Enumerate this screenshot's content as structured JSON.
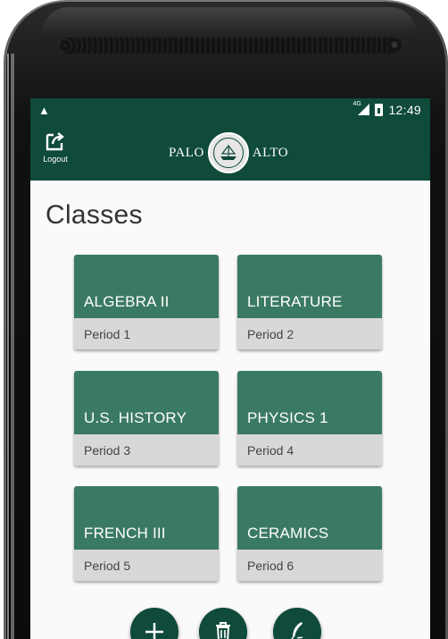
{
  "status_bar": {
    "time": "12:49",
    "network": "4G"
  },
  "app_bar": {
    "logout_label": "Logout",
    "brand_left": "PALO",
    "brand_right": "ALTO"
  },
  "page": {
    "title": "Classes"
  },
  "classes": [
    {
      "name": "ALGEBRA II",
      "period": "Period 1"
    },
    {
      "name": "LITERATURE",
      "period": "Period 2"
    },
    {
      "name": "U.S. HISTORY",
      "period": "Period 3"
    },
    {
      "name": "PHYSICS 1",
      "period": "Period 4"
    },
    {
      "name": "FRENCH III",
      "period": "Period 5"
    },
    {
      "name": "CERAMICS",
      "period": "Period 6"
    }
  ],
  "actions": {
    "add_icon": "plus-icon",
    "delete_icon": "trash-icon",
    "edit_icon": "quill-icon"
  },
  "colors": {
    "primary_dark": "#0f4a3a",
    "card_green": "#3b7a62",
    "card_footer": "#d8d8d8"
  }
}
